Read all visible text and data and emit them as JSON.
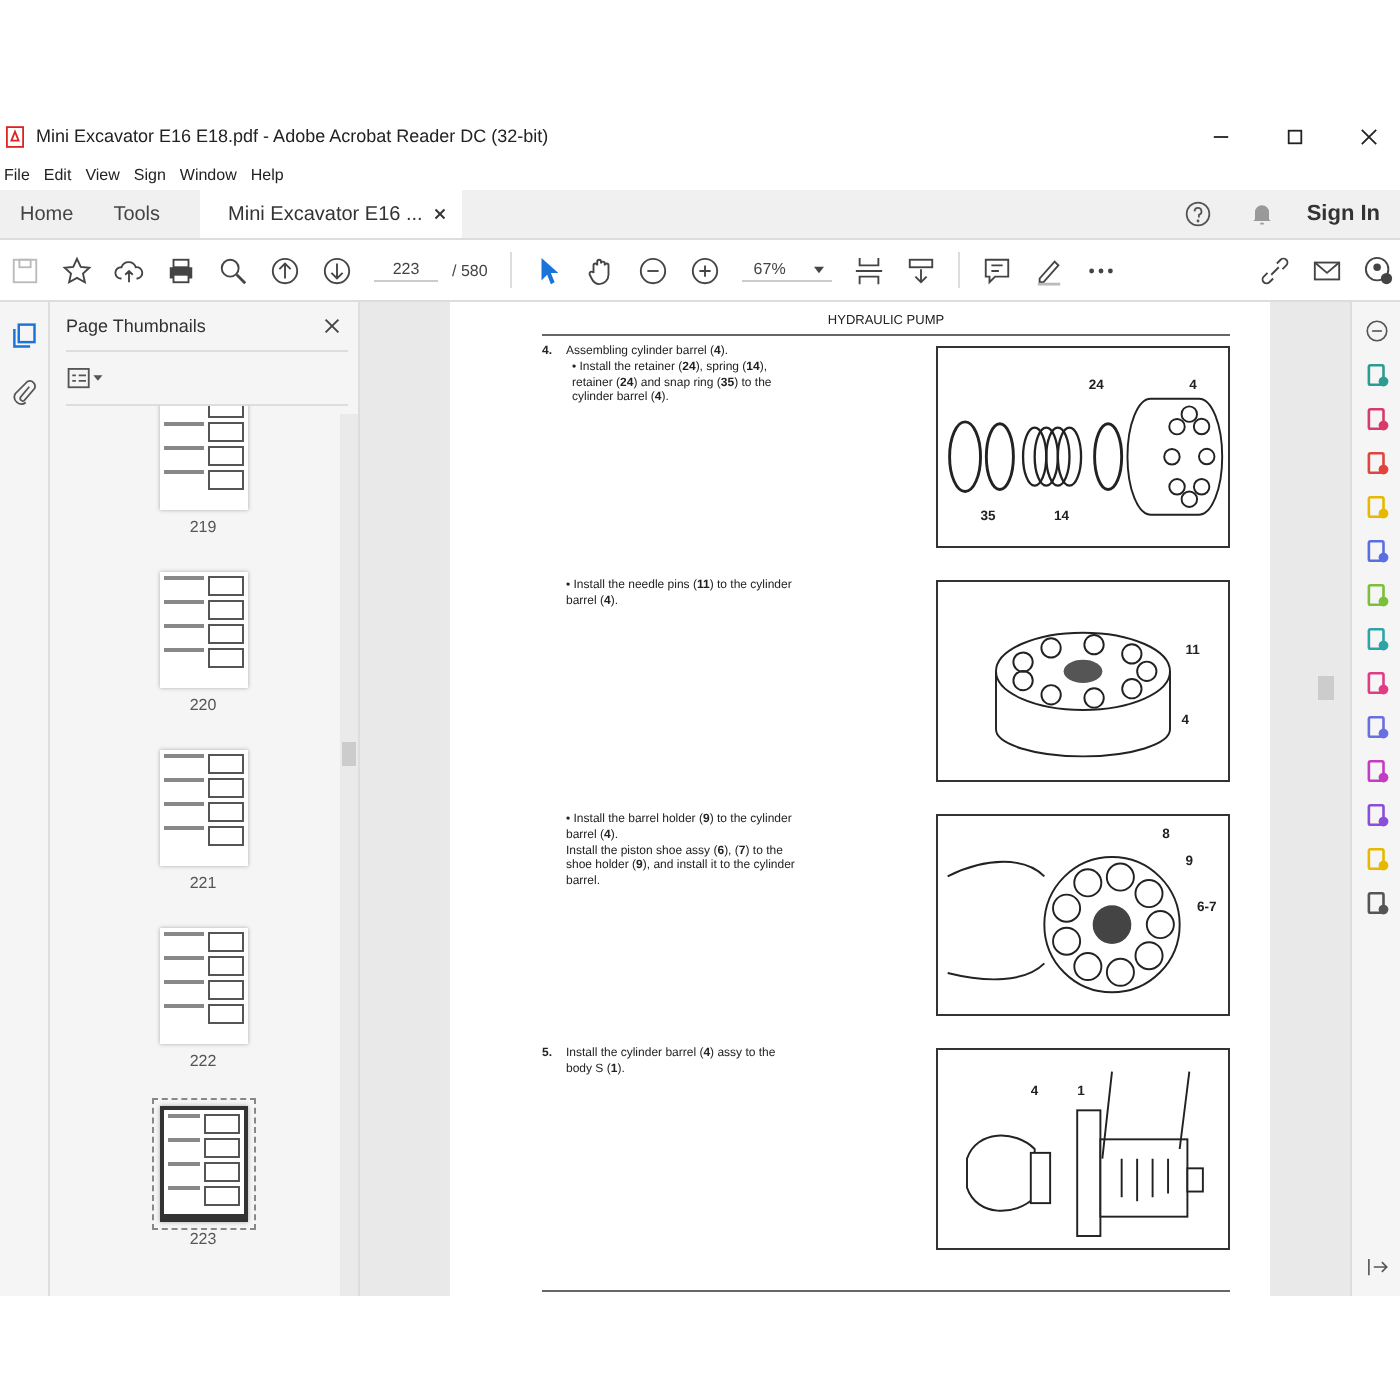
{
  "window": {
    "title": "Mini Excavator E16 E18.pdf - Adobe Acrobat Reader DC (32-bit)"
  },
  "menu": [
    "File",
    "Edit",
    "View",
    "Sign",
    "Window",
    "Help"
  ],
  "tabs": [
    {
      "label": "Home",
      "selected": false
    },
    {
      "label": "Tools",
      "selected": false
    },
    {
      "label": "Mini Excavator E16 ...",
      "selected": true
    }
  ],
  "sign_in": "Sign In",
  "toolbar": {
    "page": "223",
    "page_total": "/ 580",
    "zoom": "67%"
  },
  "panel": {
    "title": "Page Thumbnails",
    "thumbnails": [
      {
        "label": "219",
        "selected": false
      },
      {
        "label": "220",
        "selected": false
      },
      {
        "label": "221",
        "selected": false
      },
      {
        "label": "222",
        "selected": false
      },
      {
        "label": "223",
        "selected": true
      }
    ]
  },
  "document": {
    "header": "HYDRAULIC PUMP",
    "steps": [
      {
        "number": "4.",
        "title": "Assembling cylinder barrel (**4**).",
        "text": "• Install the retainer (**24**), spring (**14**), retainer (**24**) and snap ring (**35**) to the cylinder barrel (**4**).",
        "figure": {
          "kind": "rings",
          "callouts": [
            "24",
            "4",
            "35",
            "14"
          ]
        }
      },
      {
        "text": "• Install the needle pins (**11**) to the cylinder barrel (**4**).",
        "figure": {
          "kind": "barrel",
          "callouts": [
            "11",
            "4"
          ]
        }
      },
      {
        "text": "• Install the barrel holder (**9**) to the cylinder barrel (**4**).",
        "text2": "Install the piston shoe assy (**6**), (**7**) to the shoe holder (**9**), and install it to the cylinder barrel.",
        "figure": {
          "kind": "holder",
          "callouts": [
            "8",
            "9",
            "6-7"
          ]
        }
      },
      {
        "number": "5.",
        "text": "Install the cylinder barrel (**4**) assy to the body S (**1**).",
        "figure": {
          "kind": "hands",
          "callouts": [
            "4",
            "1"
          ]
        }
      }
    ]
  }
}
